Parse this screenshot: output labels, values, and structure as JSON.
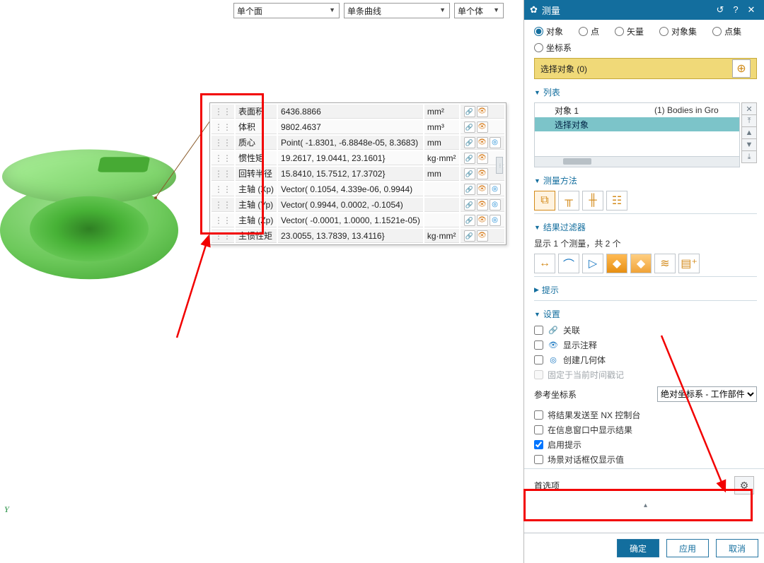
{
  "topFilters": {
    "face": "单个面",
    "curve": "单条曲线",
    "body": "单个体"
  },
  "measure": {
    "rows": [
      {
        "label": "表面积",
        "value": "6436.8866",
        "unit": "mm²",
        "target": false
      },
      {
        "label": "体积",
        "value": "9802.4637",
        "unit": "mm³",
        "target": false
      },
      {
        "label": "质心",
        "value": "Point( -1.8301, -6.8848e-05, 8.3683)",
        "unit": "mm",
        "target": true
      },
      {
        "label": "惯性矩",
        "value": "19.2617, 19.0441, 23.1601}",
        "unit": "kg·mm²",
        "target": false
      },
      {
        "label": "回转半径",
        "value": "15.8410, 15.7512, 17.3702}",
        "unit": "mm",
        "target": false
      },
      {
        "label": "主轴 (Xp)",
        "value": "Vector( 0.1054, 4.339e-06, 0.9944)",
        "unit": "",
        "target": true
      },
      {
        "label": "主轴 (Yp)",
        "value": "Vector( 0.9944, 0.0002, -0.1054)",
        "unit": "",
        "target": true
      },
      {
        "label": "主轴 (Zp)",
        "value": "Vector( -0.0001, 1.0000, 1.1521e-05)",
        "unit": "",
        "target": true
      },
      {
        "label": "主惯性矩",
        "value": "23.0055, 13.7839, 13.4116}",
        "unit": "kg·mm²",
        "target": false
      }
    ]
  },
  "panel": {
    "title": "测量",
    "radios": {
      "object": "对象",
      "point": "点",
      "vector": "矢量",
      "objectSet": "对象集",
      "pointSet": "点集",
      "coord": "坐标系"
    },
    "radioSelected": "object",
    "selectBar": "选择对象 (0)",
    "sections": {
      "list": "列表",
      "method": "测量方法",
      "filter": "结果过滤器",
      "hint": "提示",
      "settings": "设置"
    },
    "list": {
      "obj1": "对象 1",
      "obj1meta": "(1) Bodies in Gro",
      "selObj": "选择对象"
    },
    "resultCount": "显示 1 个测量，共 2 个",
    "settings": {
      "assoc": "关联",
      "showAnno": "显示注释",
      "createGeom": "创建几何体",
      "fixTime": "固定于当前时间戳记",
      "refCoord": "参考坐标系",
      "refCoordValue": "绝对坐标系 - 工作部件",
      "sendNX": "将结果发送至 NX 控制台",
      "showInfo": "在信息窗口中显示结果",
      "enableHint": "启用提示",
      "sceneOnly": "场景对话框仅显示值"
    },
    "pref": "首选项",
    "footer": {
      "ok": "确定",
      "apply": "应用",
      "cancel": "取消"
    }
  },
  "axisLabel": "Y"
}
